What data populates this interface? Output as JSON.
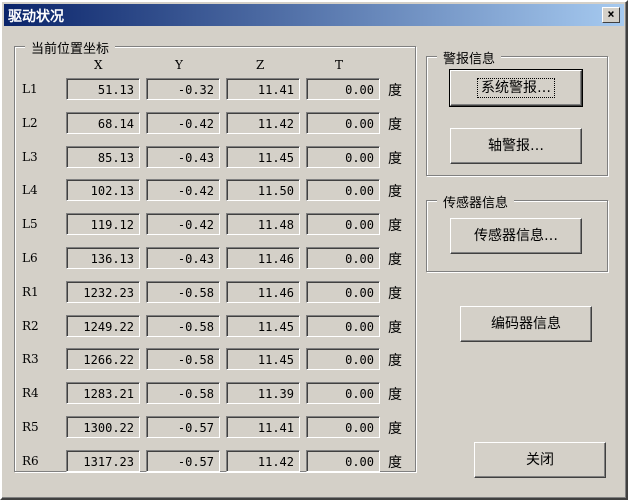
{
  "window": {
    "title": "驱动状况"
  },
  "position_group": {
    "label": "当前位置坐标",
    "columns": [
      "X",
      "Y",
      "Z",
      "T"
    ],
    "rows": [
      {
        "label": "L1",
        "x": "51.13",
        "y": "-0.32",
        "z": "11.41",
        "t": "0.00",
        "unit": "度"
      },
      {
        "label": "L2",
        "x": "68.14",
        "y": "-0.42",
        "z": "11.42",
        "t": "0.00",
        "unit": "度"
      },
      {
        "label": "L3",
        "x": "85.13",
        "y": "-0.43",
        "z": "11.45",
        "t": "0.00",
        "unit": "度"
      },
      {
        "label": "L4",
        "x": "102.13",
        "y": "-0.42",
        "z": "11.50",
        "t": "0.00",
        "unit": "度"
      },
      {
        "label": "L5",
        "x": "119.12",
        "y": "-0.42",
        "z": "11.48",
        "t": "0.00",
        "unit": "度"
      },
      {
        "label": "L6",
        "x": "136.13",
        "y": "-0.43",
        "z": "11.46",
        "t": "0.00",
        "unit": "度"
      },
      {
        "label": "R1",
        "x": "1232.23",
        "y": "-0.58",
        "z": "11.46",
        "t": "0.00",
        "unit": "度"
      },
      {
        "label": "R2",
        "x": "1249.22",
        "y": "-0.58",
        "z": "11.45",
        "t": "0.00",
        "unit": "度"
      },
      {
        "label": "R3",
        "x": "1266.22",
        "y": "-0.58",
        "z": "11.45",
        "t": "0.00",
        "unit": "度"
      },
      {
        "label": "R4",
        "x": "1283.21",
        "y": "-0.58",
        "z": "11.39",
        "t": "0.00",
        "unit": "度"
      },
      {
        "label": "R5",
        "x": "1300.22",
        "y": "-0.57",
        "z": "11.41",
        "t": "0.00",
        "unit": "度"
      },
      {
        "label": "R6",
        "x": "1317.23",
        "y": "-0.57",
        "z": "11.42",
        "t": "0.00",
        "unit": "度"
      }
    ]
  },
  "alarm_group": {
    "label": "警报信息",
    "system_alarm_button": "系统警报…",
    "axis_alarm_button": "轴警报…"
  },
  "sensor_group": {
    "label": "传感器信息",
    "sensor_button": "传感器信息…"
  },
  "encoder_button": "编码器信息",
  "close_button": "关闭",
  "titlebar_close": "×"
}
